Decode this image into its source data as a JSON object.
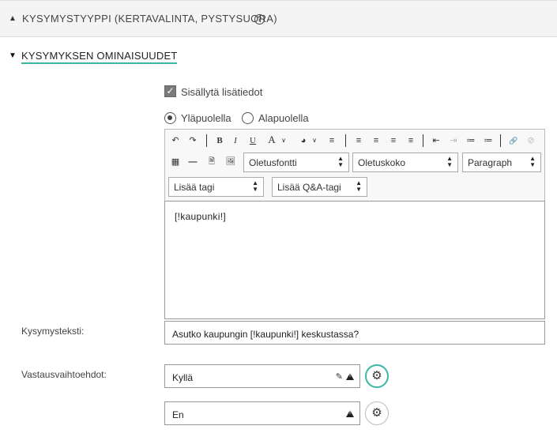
{
  "section_question_type": {
    "label": "KYSYMYSTYYPPI (KERTAVALINTA, PYSTYSUORA)",
    "arrow": "▲",
    "help": "?"
  },
  "section_properties": {
    "label": "KYSYMYKSEN OMINAISUUDET",
    "arrow": "▼"
  },
  "include_details": {
    "label": "Sisällytä lisätiedot",
    "checked": true
  },
  "position": {
    "above_label": "Yläpuolella",
    "below_label": "Alapuolella",
    "selected": "above"
  },
  "editor": {
    "toolbar_row1": {
      "undo": "↶",
      "redo": "↷",
      "bold": "B",
      "italic": "I",
      "underline": "U",
      "font_color": "A",
      "bg_color": "◕",
      "remove_format": "≡",
      "align_left": "≡",
      "align_center": "≡",
      "align_right": "≡",
      "justify": "≡",
      "indent": "⇥",
      "outdent": "⇤",
      "numbered_list": "≔",
      "bullet_list": "≔",
      "link": "🔗",
      "unlink": "⊘"
    },
    "toolbar_row2": {
      "table": "▦",
      "hr": "—",
      "document": "🗎",
      "image": "🖼",
      "font_family": "Oletusfontti",
      "font_size": "Oletuskoko",
      "block_format": "Paragraph"
    },
    "toolbar_row3": {
      "add_tag": "Lisää tagi",
      "add_qa_tag": "Lisää Q&A-tagi"
    },
    "content": "[!kaupunki!]"
  },
  "question_text": {
    "label": "Kysymysteksti:",
    "value": "Asutko kaupungin [!kaupunki!] keskustassa?"
  },
  "answer_options": {
    "label": "Vastausvaihtoehdot:",
    "items": [
      {
        "value": "Kyllä",
        "has_tag_icon": true
      },
      {
        "value": "En",
        "has_tag_icon": false
      }
    ]
  },
  "accent_color": "#3db4a8"
}
